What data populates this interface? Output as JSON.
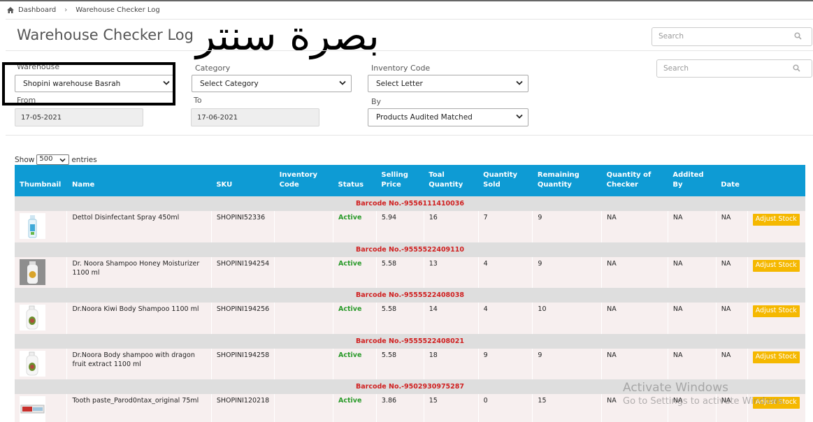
{
  "breadcrumb": {
    "home": "Dashboard",
    "current": "Warehouse Checker Log"
  },
  "page_title": "Warehouse Checker Log",
  "overlay_text": "بصرة سنتر",
  "search_top": {
    "placeholder": "Search"
  },
  "search_second": {
    "placeholder": "Search"
  },
  "filters": {
    "warehouse": {
      "label": "Warehouse",
      "value": "Shopini warehouse Basrah"
    },
    "category": {
      "label": "Category",
      "value": "Select Category"
    },
    "inventory_code": {
      "label": "Inventory Code",
      "value": "Select Letter"
    },
    "from": {
      "label": "From",
      "value": "17-05-2021"
    },
    "to": {
      "label": "To",
      "value": "17-06-2021"
    },
    "by": {
      "label": "By",
      "value": "Products Audited Matched"
    }
  },
  "show_entries": {
    "prefix": "Show",
    "value": "500",
    "suffix": "entries"
  },
  "table": {
    "headers": [
      "Thumbnail",
      "Name",
      "SKU",
      "Inventory Code",
      "Status",
      "Selling Price",
      "Toal Quantity",
      "Quantity Sold",
      "Remaining Quantity",
      "Quantity of Checker",
      "Addited By",
      "Date",
      ""
    ],
    "adjust_label": "Adjust Stock",
    "groups": [
      {
        "barcode": "Barcode No.-9556111410036",
        "name": "Dettol Disinfectant Spray 450ml",
        "sku": "SHOPINI52336",
        "inventory_code": "",
        "status": "Active",
        "price": "5.94",
        "total": "16",
        "sold": "7",
        "remaining": "9",
        "checker": "NA",
        "by": "NA",
        "date": "NA",
        "thumb": "spray-bottle"
      },
      {
        "barcode": "Barcode No.-9555522409110",
        "name": "Dr. Noora Shampoo Honey Moisturizer 1100 ml",
        "sku": "SHOPINI194254",
        "inventory_code": "",
        "status": "Active",
        "price": "5.58",
        "total": "13",
        "sold": "4",
        "remaining": "9",
        "checker": "NA",
        "by": "NA",
        "date": "NA",
        "thumb": "shampoo-bottle-grey"
      },
      {
        "barcode": "Barcode No.-9555522408038",
        "name": "Dr.Noora Kiwi Body Shampoo 1100 ml",
        "sku": "SHOPINI194256",
        "inventory_code": "",
        "status": "Active",
        "price": "5.58",
        "total": "14",
        "sold": "4",
        "remaining": "10",
        "checker": "NA",
        "by": "NA",
        "date": "NA",
        "thumb": "shampoo-bottle-white"
      },
      {
        "barcode": "Barcode No.-9555522408021",
        "name": "Dr.Noora Body shampoo with dragon fruit extract 1100 ml",
        "sku": "SHOPINI194258",
        "inventory_code": "",
        "status": "Active",
        "price": "5.58",
        "total": "18",
        "sold": "9",
        "remaining": "9",
        "checker": "NA",
        "by": "NA",
        "date": "NA",
        "thumb": "shampoo-bottle-white"
      },
      {
        "barcode": "Barcode No.-9502930975287",
        "name": "Tooth paste_Parod0ntax_original 75ml",
        "sku": "SHOPINI120218",
        "inventory_code": "",
        "status": "Active",
        "price": "3.86",
        "total": "15",
        "sold": "0",
        "remaining": "15",
        "checker": "NA",
        "by": "NA",
        "date": "NA",
        "thumb": "toothpaste-box"
      }
    ]
  },
  "watermark": {
    "line1": "Activate Windows",
    "line2": "Go to Settings to activate Windows."
  },
  "colors": {
    "header_bg": "#0e9bd4",
    "barcode_text": "#d02020",
    "status_active": "#2a9a2a",
    "adjust_button": "#f5b800",
    "row_bg": "#f7efef",
    "barcode_row_bg": "#dedede"
  }
}
